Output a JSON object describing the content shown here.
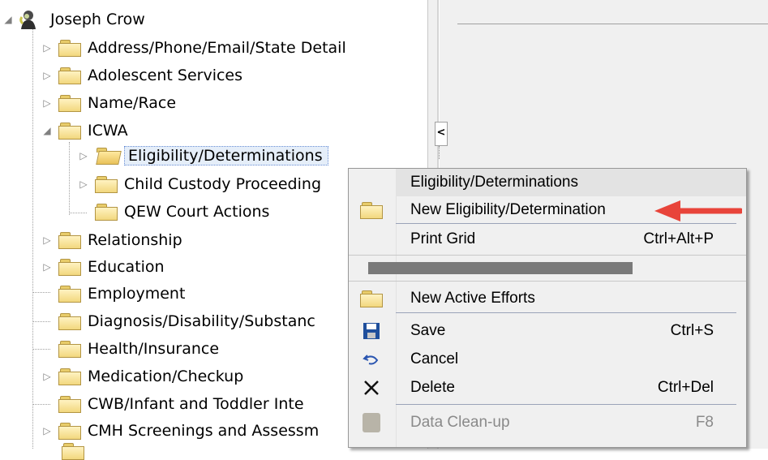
{
  "tree": {
    "root": "Joseph Crow",
    "items": [
      {
        "label": "Address/Phone/Email/State Detail",
        "expander": "collapsed"
      },
      {
        "label": "Adolescent Services",
        "expander": "collapsed"
      },
      {
        "label": "Name/Race",
        "expander": "collapsed"
      },
      {
        "label": "ICWA",
        "expander": "expanded"
      },
      {
        "label": "Eligibility/Determinations",
        "expander": "collapsed",
        "selected": true
      },
      {
        "label": "Child Custody Proceeding",
        "expander": "collapsed"
      },
      {
        "label": "QEW Court Actions",
        "expander": "none"
      },
      {
        "label": "Relationship",
        "expander": "collapsed"
      },
      {
        "label": "Education",
        "expander": "collapsed"
      },
      {
        "label": "Employment",
        "expander": "none"
      },
      {
        "label": "Diagnosis/Disability/Substanc",
        "expander": "none"
      },
      {
        "label": "Health/Insurance",
        "expander": "none"
      },
      {
        "label": "Medication/Checkup",
        "expander": "collapsed"
      },
      {
        "label": "CWB/Infant and Toddler Inte",
        "expander": "none"
      },
      {
        "label": "CMH Screenings and Assessm",
        "expander": "collapsed"
      }
    ]
  },
  "splitter": {
    "collapse_glyph": "<"
  },
  "context_menu": {
    "header": "Eligibility/Determinations",
    "items": [
      {
        "label": "New Eligibility/Determination",
        "accel": "N",
        "shortcut": "",
        "icon": "folder-icon"
      },
      {
        "label": "Print Grid",
        "accel": "G",
        "shortcut": "Ctrl+Alt+P",
        "icon": ""
      },
      {
        "label": "New Active Efforts",
        "accel": "w",
        "shortcut": "",
        "icon": "folder-icon"
      },
      {
        "label": "Save",
        "accel": "S",
        "shortcut": "Ctrl+S",
        "icon": "save-icon"
      },
      {
        "label": "Cancel",
        "accel": "C",
        "shortcut": "",
        "icon": "undo-icon"
      },
      {
        "label": "Delete",
        "accel": "D",
        "shortcut": "Ctrl+Del",
        "icon": "delete-x-icon"
      },
      {
        "label": "Data Clean-up",
        "accel": "t",
        "shortcut": "F8",
        "icon": "clean-up-icon",
        "disabled": true
      }
    ]
  },
  "colors": {
    "arrow": "#e8443a",
    "selection": "#e5eef9"
  }
}
